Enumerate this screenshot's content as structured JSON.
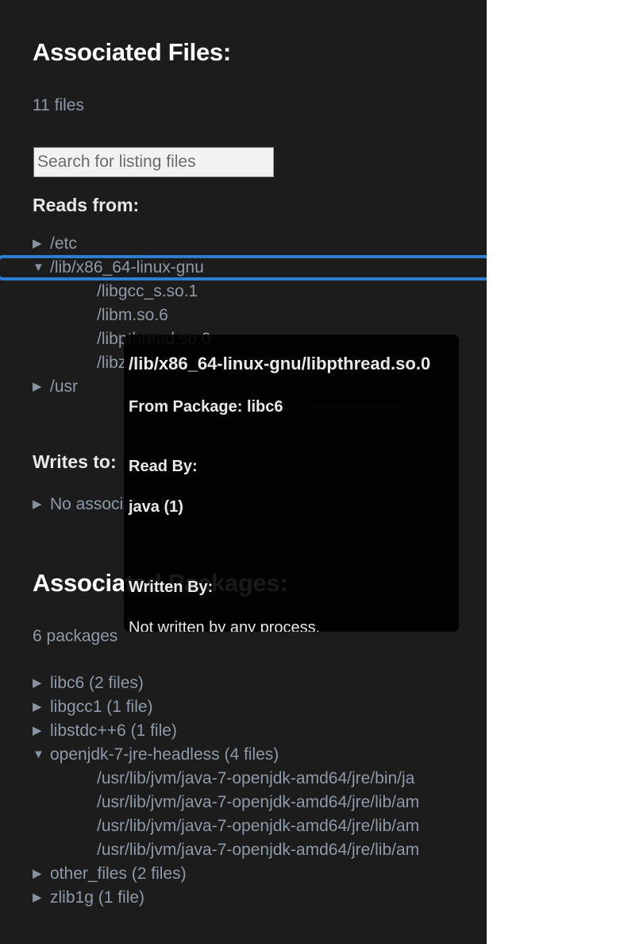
{
  "panel": {
    "title": "Associated Files:",
    "file_count": "11 files",
    "search_placeholder": "Search for listing files",
    "reads_heading": "Reads from:",
    "writes_heading": "Writes to:",
    "packages_title": "Associated Packages:",
    "package_count": "6 packages",
    "accent_color": "#2d7dd2",
    "background_color": "#1c1c1c",
    "muted_text_color": "#8e9aa8"
  },
  "icons": {
    "collapsed": "▶",
    "expanded": "▼"
  },
  "reads_from": [
    {
      "label": "/etc",
      "icon": "collapsed",
      "type": "dir",
      "selected": false
    },
    {
      "label": "/lib/x86_64-linux-gnu",
      "icon": "expanded",
      "type": "dir",
      "selected": true
    },
    {
      "label": "/libgcc_s.so.1",
      "icon": "",
      "type": "file",
      "selected": false
    },
    {
      "label": "/libm.so.6",
      "icon": "",
      "type": "file",
      "selected": false
    },
    {
      "label": "/libpthread.so.0",
      "icon": "",
      "type": "file",
      "selected": false
    },
    {
      "label": "/libz.so.1",
      "icon": "",
      "type": "file",
      "selected": false
    },
    {
      "label": "/usr",
      "icon": "collapsed",
      "type": "dir",
      "selected": false
    }
  ],
  "writes_to": [
    {
      "label": "No associated file.",
      "icon": "collapsed",
      "type": "empty",
      "selected": false
    }
  ],
  "packages": [
    {
      "label": "libc6 (2 files)",
      "icon": "collapsed",
      "type": "pkg",
      "selected": false
    },
    {
      "label": "libgcc1 (1 file)",
      "icon": "collapsed",
      "type": "pkg",
      "selected": false
    },
    {
      "label": "libstdc++6 (1 file)",
      "icon": "collapsed",
      "type": "pkg",
      "selected": false
    },
    {
      "label": "openjdk-7-jre-headless (4 files)",
      "icon": "expanded",
      "type": "pkg",
      "selected": false
    },
    {
      "label": "/usr/lib/jvm/java-7-openjdk-amd64/jre/bin/ja",
      "icon": "",
      "type": "file",
      "selected": false
    },
    {
      "label": "/usr/lib/jvm/java-7-openjdk-amd64/jre/lib/am",
      "icon": "",
      "type": "file",
      "selected": false
    },
    {
      "label": "/usr/lib/jvm/java-7-openjdk-amd64/jre/lib/am",
      "icon": "",
      "type": "file",
      "selected": false
    },
    {
      "label": "/usr/lib/jvm/java-7-openjdk-amd64/jre/lib/am",
      "icon": "",
      "type": "file",
      "selected": false
    },
    {
      "label": "other_files (2 files)",
      "icon": "collapsed",
      "type": "pkg",
      "selected": false
    },
    {
      "label": "zlib1g (1 file)",
      "icon": "collapsed",
      "type": "pkg",
      "selected": false
    }
  ],
  "tooltip": {
    "path": "/lib/x86_64-linux-gnu/libpthread.so.0",
    "package_line": "From Package: libc6",
    "read_by_heading": "Read By:",
    "read_by_item": "java (1)",
    "written_by_heading": "Written By:",
    "written_by_item": "Not written by any process."
  }
}
